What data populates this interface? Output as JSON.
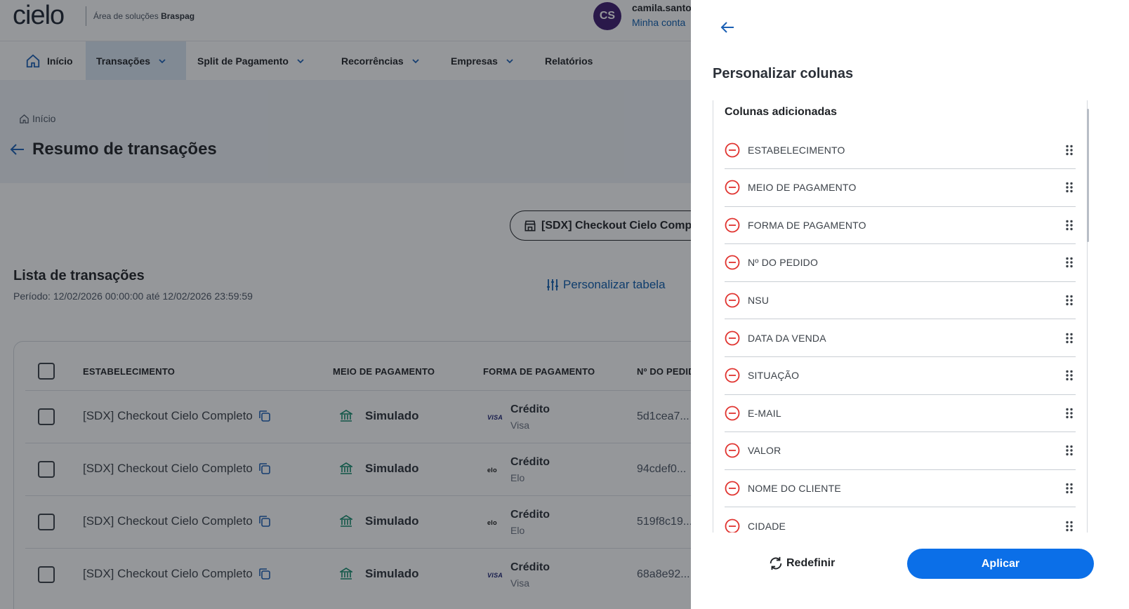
{
  "header": {
    "logo_text": "cielo",
    "subtitle_prefix": "Área de soluções ",
    "subtitle_brand": "Braspag",
    "avatar_initials": "CS",
    "user_name": "camila.santos",
    "account_link": "Minha conta"
  },
  "nav": {
    "items": [
      {
        "label": "Início"
      },
      {
        "label": "Transações"
      },
      {
        "label": "Split de Pagamento"
      },
      {
        "label": "Recorrências"
      },
      {
        "label": "Empresas"
      },
      {
        "label": "Relatórios"
      }
    ]
  },
  "breadcrumb": {
    "label": "Início"
  },
  "page": {
    "title": "Resumo de transações"
  },
  "merchant_pill": {
    "label": "[SDX] Checkout Cielo Completo"
  },
  "list": {
    "title": "Lista de transações",
    "period": "Período: 12/02/2026 00:00:00 até 12/02/2026 23:59:59",
    "customize_label": "Personalizar tabela"
  },
  "table": {
    "headers": [
      "ESTABELECIMENTO",
      "MEIO DE PAGAMENTO",
      "FORMA DE PAGAMENTO",
      "Nº DO PEDIDO"
    ],
    "rows": [
      {
        "merchant": "[SDX] Checkout Cielo Completo",
        "method": "Simulado",
        "form": "Crédito",
        "brand": "Visa",
        "brand_mark": "VISA",
        "order": "5d1cea7..."
      },
      {
        "merchant": "[SDX] Checkout Cielo Completo",
        "method": "Simulado",
        "form": "Crédito",
        "brand": "Elo",
        "brand_mark": "elo",
        "order": "94cdef0..."
      },
      {
        "merchant": "[SDX] Checkout Cielo Completo",
        "method": "Simulado",
        "form": "Crédito",
        "brand": "Elo",
        "brand_mark": "elo",
        "order": "519f8c19..."
      },
      {
        "merchant": "[SDX] Checkout Cielo Completo",
        "method": "Simulado",
        "form": "Crédito",
        "brand": "Visa",
        "brand_mark": "VISA",
        "order": "68a8e92..."
      }
    ]
  },
  "drawer": {
    "title": "Personalizar colunas",
    "section_heading": "Colunas adicionadas",
    "columns": [
      "ESTABELECIMENTO",
      "MEIO DE PAGAMENTO",
      "FORMA DE PAGAMENTO",
      "Nº DO PEDIDO",
      "NSU",
      "DATA DA VENDA",
      "SITUAÇÃO",
      "E-MAIL",
      "VALOR",
      "NOME DO CLIENTE",
      "CIDADE"
    ],
    "reset_label": "Redefinir",
    "apply_label": "Aplicar"
  },
  "colors": {
    "primary_blue": "#0b6fe8",
    "link_blue": "#0b5cad",
    "remove_red": "#e0332f",
    "avatar_purple": "#3d1a6e",
    "nav_active_bg": "#dbe7f5"
  },
  "icons": {
    "home": "home-icon",
    "back": "arrow-left-icon",
    "chevron": "chevron-down-icon",
    "store": "store-icon",
    "sliders": "sliders-icon",
    "copy": "copy-icon",
    "bank": "bank-icon",
    "remove": "minus-circle-icon",
    "drag": "drag-handle-icon",
    "reset": "refresh-icon"
  }
}
